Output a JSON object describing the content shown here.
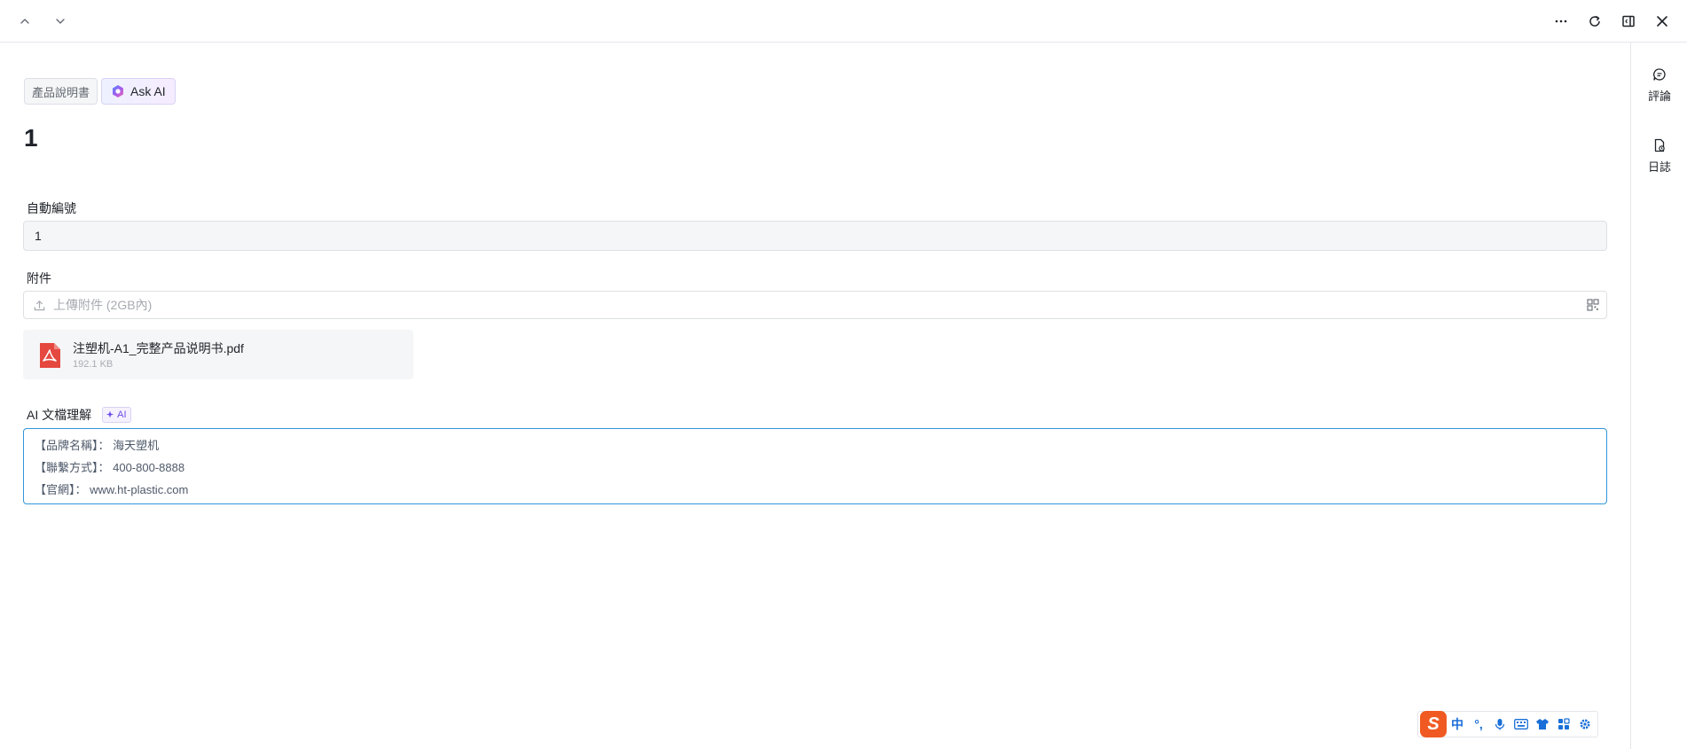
{
  "header": {
    "prev_icon": "chevron-up-icon",
    "next_icon": "chevron-down-icon",
    "more_icon": "more-icon",
    "refresh_icon": "refresh-icon",
    "panel_icon": "panel-toggle-icon",
    "close_icon": "close-icon"
  },
  "sidebar": {
    "items": [
      {
        "label": "評論",
        "icon": "comment-icon"
      },
      {
        "label": "日誌",
        "icon": "log-icon"
      }
    ]
  },
  "tags": {
    "doc_tag": "產品說明書",
    "ask_ai": "Ask AI"
  },
  "record": {
    "title": "1"
  },
  "fields": {
    "autonum": {
      "label": "自動編號",
      "value": "1"
    },
    "attachment": {
      "label": "附件",
      "placeholder": "上傳附件 (2GB內)",
      "file": {
        "name": "注塑机-A1_完整产品说明书.pdf",
        "size": "192.1 KB"
      }
    },
    "ai_understanding": {
      "label": "AI 文檔理解",
      "badge": "AI",
      "lines": [
        "【品牌名稱】：  海天塑机",
        "【聯繫方式】：  400-800-8888",
        "【官網】：  www.ht-plastic.com"
      ]
    }
  },
  "ime_toolbar": {
    "logo": "S",
    "lang": "中",
    "punct": "°,",
    "colors": {
      "accent": "#1a6fd8",
      "brand": "#f05a22"
    }
  }
}
